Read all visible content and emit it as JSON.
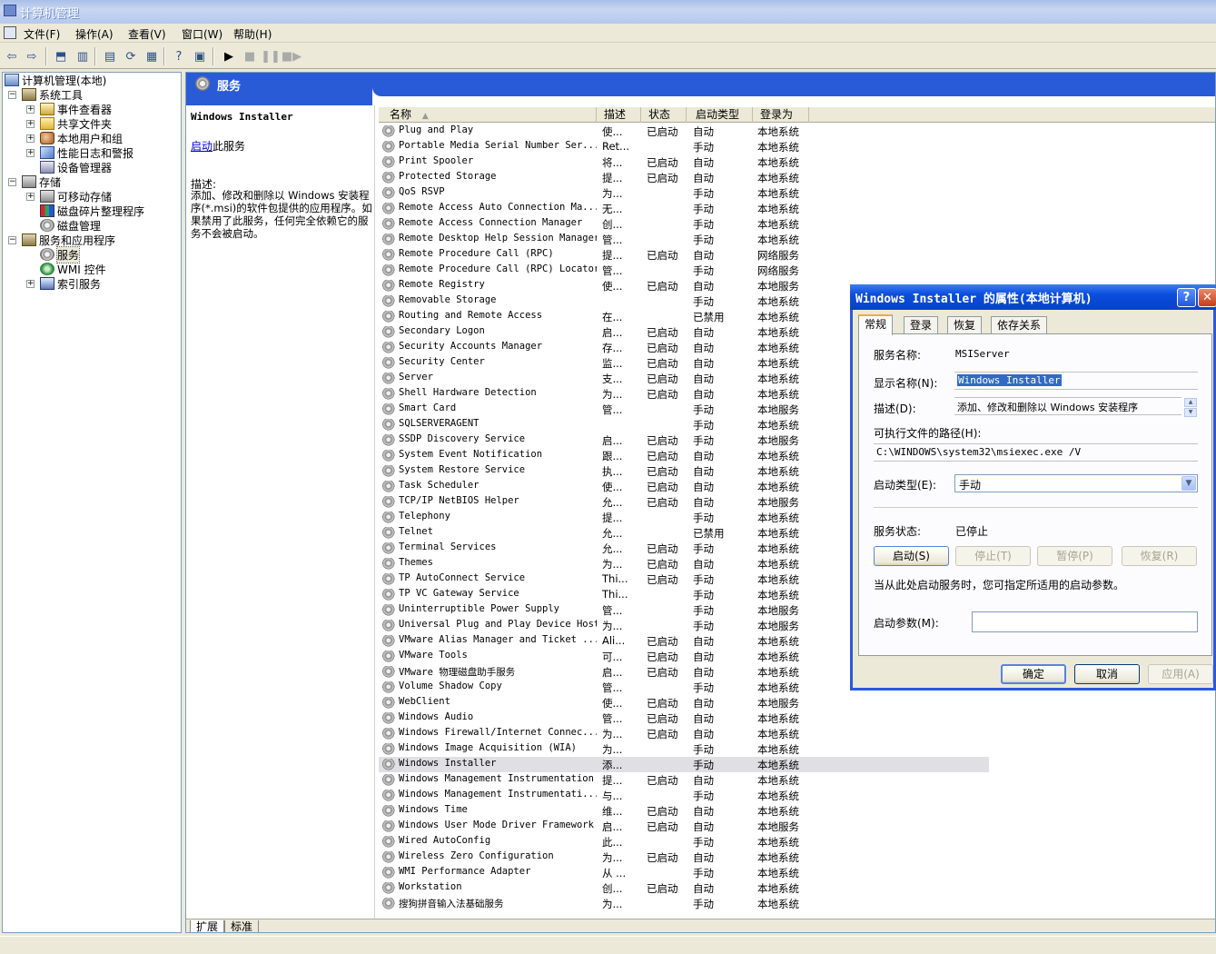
{
  "window": {
    "title": "计算机管理"
  },
  "menu": {
    "items": [
      "文件(F)",
      "操作(A)",
      "查看(V)",
      "窗口(W)",
      "帮助(H)"
    ]
  },
  "toolbar": {
    "icons": [
      "back-icon",
      "forward-icon",
      "up-folder-icon",
      "show-hide-tree-icon",
      "properties-icon",
      "refresh-icon",
      "export-list-icon",
      "help-icon",
      "show-tree-icon",
      "start-service-icon",
      "stop-service-icon",
      "pause-service-icon",
      "restart-service-icon"
    ]
  },
  "tree": {
    "root": "计算机管理(本地)",
    "items": [
      {
        "label": "系统工具"
      },
      {
        "label": "事件查看器"
      },
      {
        "label": "共享文件夹"
      },
      {
        "label": "本地用户和组"
      },
      {
        "label": "性能日志和警报"
      },
      {
        "label": "设备管理器"
      },
      {
        "label": "存储"
      },
      {
        "label": "可移动存储"
      },
      {
        "label": "磁盘碎片整理程序"
      },
      {
        "label": "磁盘管理"
      },
      {
        "label": "服务和应用程序"
      },
      {
        "label": "服务"
      },
      {
        "label": "WMI 控件"
      },
      {
        "label": "索引服务"
      }
    ]
  },
  "services_pane": {
    "title": "服务",
    "selected_service": "Windows Installer",
    "start_link": "启动",
    "start_suffix": "此服务",
    "desc_label": "描述:",
    "desc_text": "添加、修改和删除以 Windows 安装程序(*.msi)的软件包提供的应用程序。如果禁用了此服务，任何完全依赖它的服务不会被启动。",
    "columns": [
      "名称",
      "描述",
      "状态",
      "启动类型",
      "登录为"
    ],
    "rows": [
      [
        "Plug and Play",
        "使...",
        "已启动",
        "自动",
        "本地系统"
      ],
      [
        "Portable Media Serial Number Ser...",
        "Ret...",
        "",
        "手动",
        "本地系统"
      ],
      [
        "Print Spooler",
        "将...",
        "已启动",
        "自动",
        "本地系统"
      ],
      [
        "Protected Storage",
        "提...",
        "已启动",
        "自动",
        "本地系统"
      ],
      [
        "QoS RSVP",
        "为...",
        "",
        "手动",
        "本地系统"
      ],
      [
        "Remote Access Auto Connection Ma...",
        "无...",
        "",
        "手动",
        "本地系统"
      ],
      [
        "Remote Access Connection Manager",
        "创...",
        "",
        "手动",
        "本地系统"
      ],
      [
        "Remote Desktop Help Session Manager",
        "管...",
        "",
        "手动",
        "本地系统"
      ],
      [
        "Remote Procedure Call (RPC)",
        "提...",
        "已启动",
        "自动",
        "网络服务"
      ],
      [
        "Remote Procedure Call (RPC) Locator",
        "管...",
        "",
        "手动",
        "网络服务"
      ],
      [
        "Remote Registry",
        "使...",
        "已启动",
        "自动",
        "本地服务"
      ],
      [
        "Removable Storage",
        "",
        "",
        "手动",
        "本地系统"
      ],
      [
        "Routing and Remote Access",
        "在...",
        "",
        "已禁用",
        "本地系统"
      ],
      [
        "Secondary Logon",
        "启...",
        "已启动",
        "自动",
        "本地系统"
      ],
      [
        "Security Accounts Manager",
        "存...",
        "已启动",
        "自动",
        "本地系统"
      ],
      [
        "Security Center",
        "监...",
        "已启动",
        "自动",
        "本地系统"
      ],
      [
        "Server",
        "支...",
        "已启动",
        "自动",
        "本地系统"
      ],
      [
        "Shell Hardware Detection",
        "为...",
        "已启动",
        "自动",
        "本地系统"
      ],
      [
        "Smart Card",
        "管...",
        "",
        "手动",
        "本地服务"
      ],
      [
        "SQLSERVERAGENT",
        "",
        "",
        "手动",
        "本地系统"
      ],
      [
        "SSDP Discovery Service",
        "启...",
        "已启动",
        "手动",
        "本地服务"
      ],
      [
        "System Event Notification",
        "跟...",
        "已启动",
        "自动",
        "本地系统"
      ],
      [
        "System Restore Service",
        "执...",
        "已启动",
        "自动",
        "本地系统"
      ],
      [
        "Task Scheduler",
        "使...",
        "已启动",
        "自动",
        "本地系统"
      ],
      [
        "TCP/IP NetBIOS Helper",
        "允...",
        "已启动",
        "自动",
        "本地服务"
      ],
      [
        "Telephony",
        "提...",
        "",
        "手动",
        "本地系统"
      ],
      [
        "Telnet",
        "允...",
        "",
        "已禁用",
        "本地系统"
      ],
      [
        "Terminal Services",
        "允...",
        "已启动",
        "手动",
        "本地系统"
      ],
      [
        "Themes",
        "为...",
        "已启动",
        "自动",
        "本地系统"
      ],
      [
        "TP AutoConnect Service",
        "Thi...",
        "已启动",
        "手动",
        "本地系统"
      ],
      [
        "TP VC Gateway Service",
        "Thi...",
        "",
        "手动",
        "本地系统"
      ],
      [
        "Uninterruptible Power Supply",
        "管...",
        "",
        "手动",
        "本地服务"
      ],
      [
        "Universal Plug and Play Device Host",
        "为...",
        "",
        "手动",
        "本地服务"
      ],
      [
        "VMware Alias Manager and Ticket ...",
        "Ali...",
        "已启动",
        "自动",
        "本地系统"
      ],
      [
        "VMware Tools",
        "可...",
        "已启动",
        "自动",
        "本地系统"
      ],
      [
        "VMware 物理磁盘助手服务",
        "启...",
        "已启动",
        "自动",
        "本地系统"
      ],
      [
        "Volume Shadow Copy",
        "管...",
        "",
        "手动",
        "本地系统"
      ],
      [
        "WebClient",
        "使...",
        "已启动",
        "自动",
        "本地服务"
      ],
      [
        "Windows Audio",
        "管...",
        "已启动",
        "自动",
        "本地系统"
      ],
      [
        "Windows Firewall/Internet Connec...",
        "为...",
        "已启动",
        "自动",
        "本地系统"
      ],
      [
        "Windows Image Acquisition (WIA)",
        "为...",
        "",
        "手动",
        "本地系统"
      ],
      [
        "Windows Installer",
        "添...",
        "",
        "手动",
        "本地系统"
      ],
      [
        "Windows Management Instrumentation",
        "提...",
        "已启动",
        "自动",
        "本地系统"
      ],
      [
        "Windows Management Instrumentati...",
        "与...",
        "",
        "手动",
        "本地系统"
      ],
      [
        "Windows Time",
        "维...",
        "已启动",
        "自动",
        "本地系统"
      ],
      [
        "Windows User Mode Driver Framework",
        "启...",
        "已启动",
        "自动",
        "本地服务"
      ],
      [
        "Wired AutoConfig",
        "此...",
        "",
        "手动",
        "本地系统"
      ],
      [
        "Wireless Zero Configuration",
        "为...",
        "已启动",
        "自动",
        "本地系统"
      ],
      [
        "WMI Performance Adapter",
        "从 ...",
        "",
        "手动",
        "本地系统"
      ],
      [
        "Workstation",
        "创...",
        "已启动",
        "自动",
        "本地系统"
      ],
      [
        "搜狗拼音输入法基础服务",
        "为...",
        "",
        "手动",
        "本地系统"
      ]
    ],
    "selected_row_index": 41,
    "bottom_tabs": [
      "扩展",
      "标准"
    ]
  },
  "dialog": {
    "title": "Windows Installer 的属性(本地计算机)",
    "tabs": [
      "常规",
      "登录",
      "恢复",
      "依存关系"
    ],
    "service_name_label": "服务名称:",
    "service_name": "MSIServer",
    "display_name_label": "显示名称(N):",
    "display_name": "Windows Installer",
    "description_label": "描述(D):",
    "description": "添加、修改和删除以 Windows 安装程序",
    "exe_path_label": "可执行文件的路径(H):",
    "exe_path": "C:\\WINDOWS\\system32\\msiexec.exe /V",
    "startup_type_label": "启动类型(E):",
    "startup_type": "手动",
    "status_label": "服务状态:",
    "status": "已停止",
    "buttons": {
      "start": "启动(S)",
      "stop": "停止(T)",
      "pause": "暂停(P)",
      "resume": "恢复(R)"
    },
    "hint": "当从此处启动服务时，您可指定所适用的启动参数。",
    "params_label": "启动参数(M):",
    "params_value": "",
    "ok": "确定",
    "cancel": "取消",
    "apply": "应用(A)"
  }
}
